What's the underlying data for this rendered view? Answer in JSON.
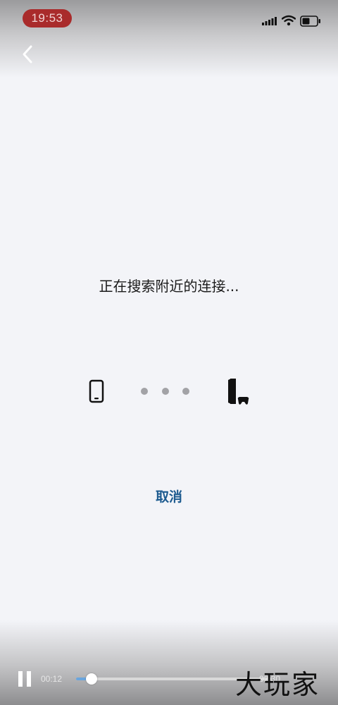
{
  "status_bar": {
    "time": "19:53",
    "icons": [
      "signal-icon",
      "wifi-icon",
      "battery-icon"
    ],
    "pill_color": "#a92b2b"
  },
  "nav": {
    "back_icon": "chevron-left-icon"
  },
  "main": {
    "message": "正在搜索附近的连接...",
    "device_icons": [
      "phone-icon",
      "console-icon"
    ],
    "connection_dots": 3,
    "cancel_label": "取消",
    "accent_color": "#1c5a8f"
  },
  "video_player": {
    "elapsed": "00:12",
    "duration": "02:30",
    "progress_fraction": 0.08,
    "progress_color": "#6aa5dd"
  },
  "watermark": {
    "text": "大玩家"
  }
}
